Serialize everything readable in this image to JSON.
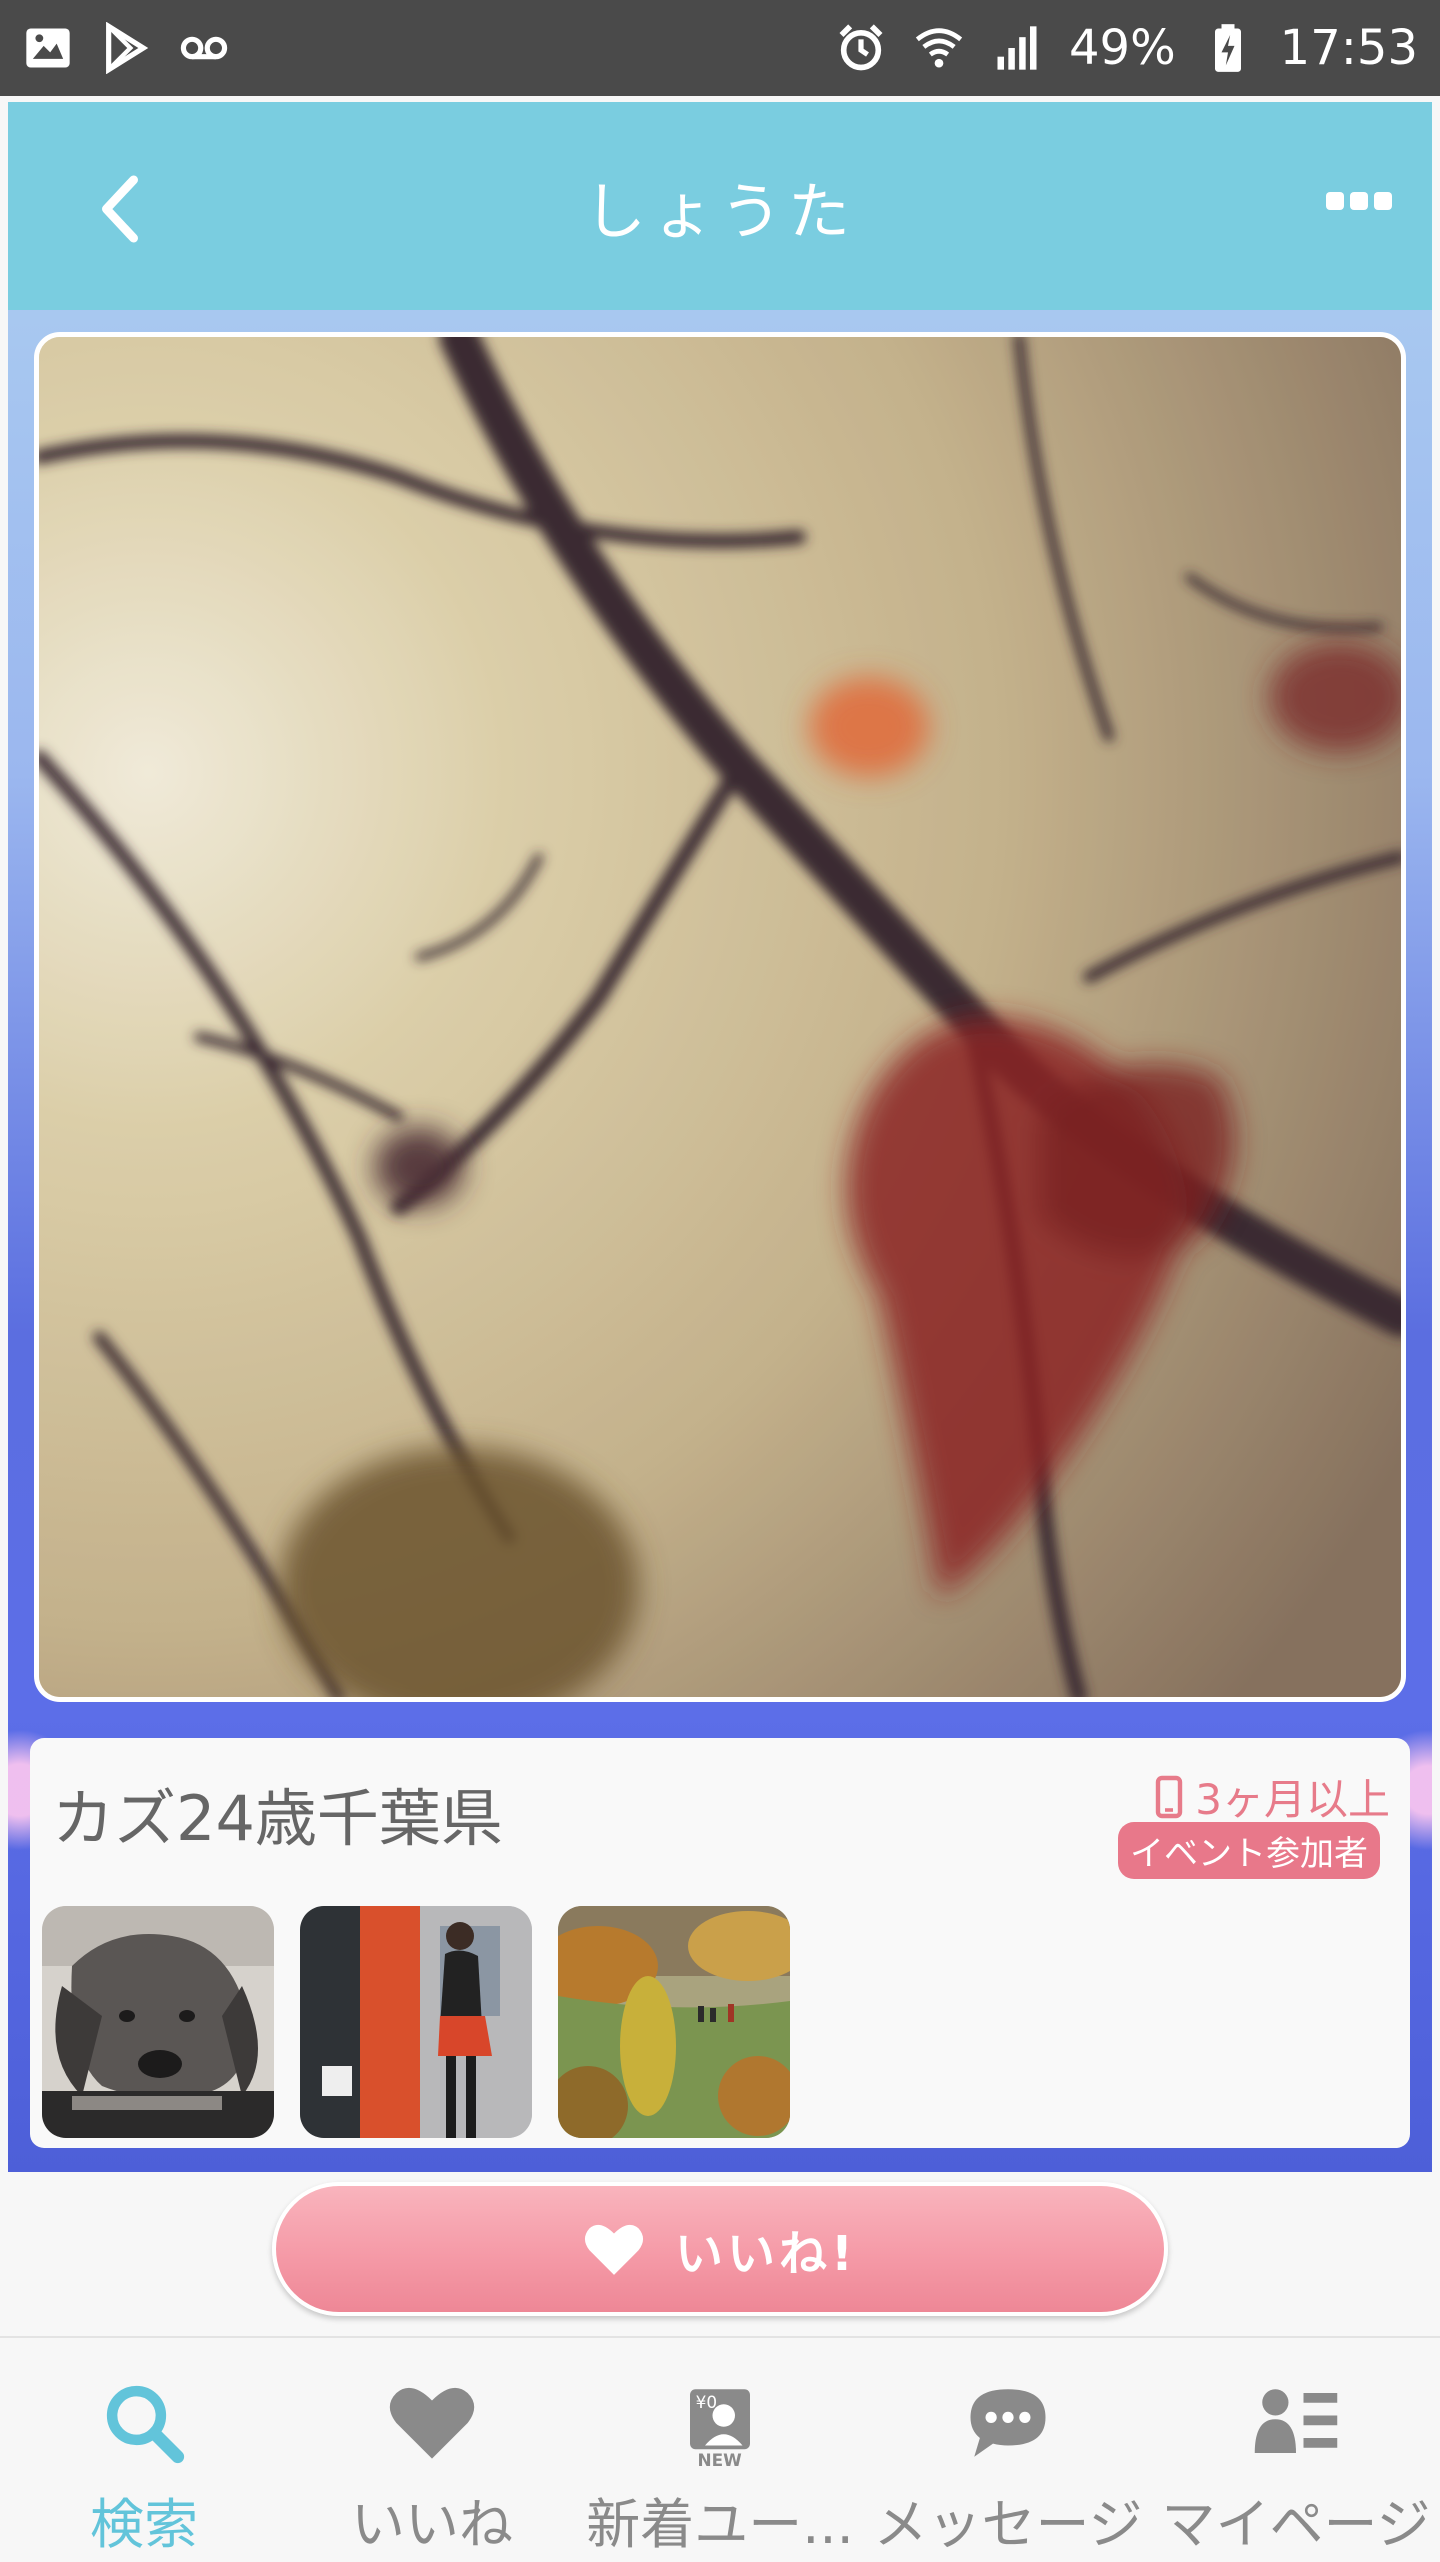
{
  "status_bar": {
    "battery": "49%",
    "time": "17:53",
    "icons": [
      "image-icon",
      "play-store-icon",
      "voicemail-icon",
      "alarm-icon",
      "wifi-icon",
      "signal-icon",
      "battery-charging-icon"
    ]
  },
  "header": {
    "title": "しょうた",
    "back_icon": "chevron-left-icon",
    "more_icon": "more-icon"
  },
  "profile": {
    "summary": "カズ24歳千葉県",
    "login_status": "3ヶ月以上",
    "badge": "イベント参加者"
  },
  "like_button": {
    "label": "いいね!"
  },
  "bottom_nav": {
    "items": [
      {
        "label": "検索",
        "icon": "search-icon",
        "active": true
      },
      {
        "label": "いいね",
        "icon": "heart-icon",
        "active": false
      },
      {
        "label": "新着ユー...",
        "icon": "new-user-icon",
        "active": false
      },
      {
        "label": "メッセージ",
        "icon": "chat-bubble-icon",
        "active": false
      },
      {
        "label": "マイページ",
        "icon": "profile-list-icon",
        "active": false
      }
    ]
  },
  "colors": {
    "header": "#7acde0",
    "accent_pink": "#e8788a",
    "nav_active": "#62c4da",
    "nav_inactive": "#8a8a8a"
  }
}
